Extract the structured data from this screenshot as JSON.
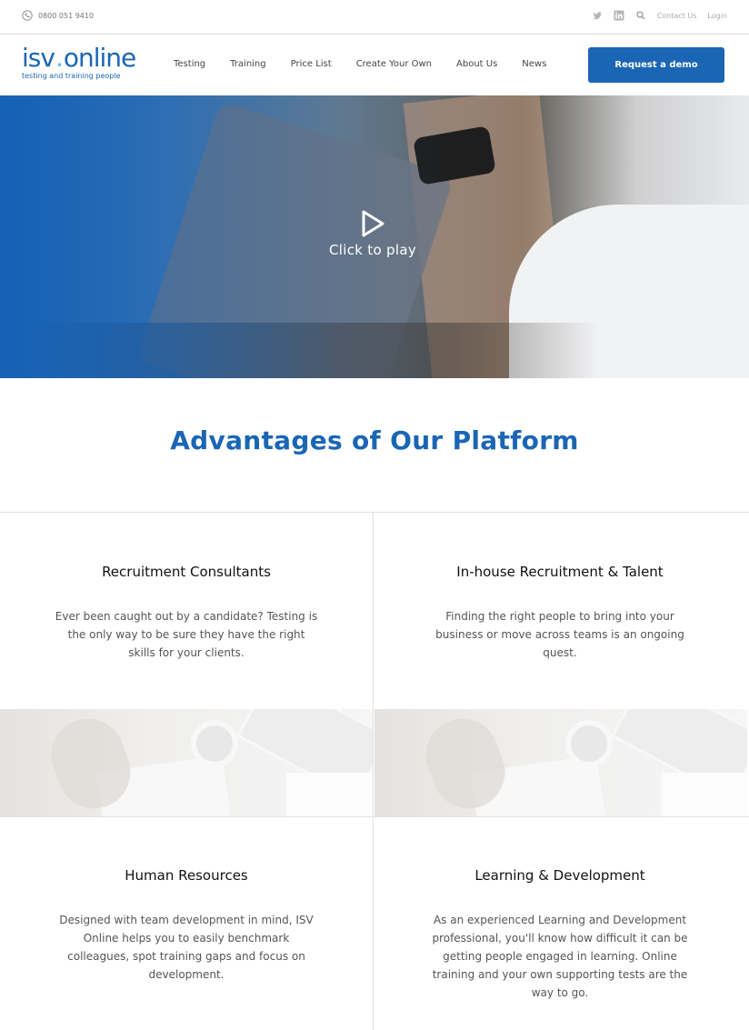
{
  "topbar": {
    "phone": "0800 051 9410",
    "contact_label": "Contact Us",
    "login_label": "Login",
    "icons": [
      "phone-icon",
      "twitter-icon",
      "linkedin-icon",
      "search-icon"
    ]
  },
  "header": {
    "logo_main_left": "isv",
    "logo_main_dot": ".",
    "logo_main_right": "online",
    "logo_tagline": "testing and training people",
    "nav": [
      "Testing",
      "Training",
      "Price List",
      "Create Your Own",
      "About Us",
      "News"
    ],
    "cta_label": "Request a demo"
  },
  "hero": {
    "play_label": "Click to play"
  },
  "advantages": {
    "title": "Advantages of Our Platform",
    "cards": [
      {
        "title": "Recruitment Consultants",
        "text": "Ever been caught out by a candidate? Testing is the only way to be sure they have the right skills for your clients."
      },
      {
        "title": "In-house Recruitment & Talent",
        "text": "Finding the right people to bring into your business or move across teams is an ongoing quest."
      },
      {
        "title": "Human Resources",
        "text": "Designed with team development in mind, ISV Online helps you to easily benchmark colleagues, spot training gaps and focus on development."
      },
      {
        "title": "Learning & Development",
        "text": "As an experienced Learning and Development professional, you'll know how difficult it can be getting people engaged in learning. Online training and your own supporting tests are the way to go."
      }
    ]
  },
  "colors": {
    "brand_blue": "#1a66b5",
    "logo_dot": "#5cb8e6"
  }
}
